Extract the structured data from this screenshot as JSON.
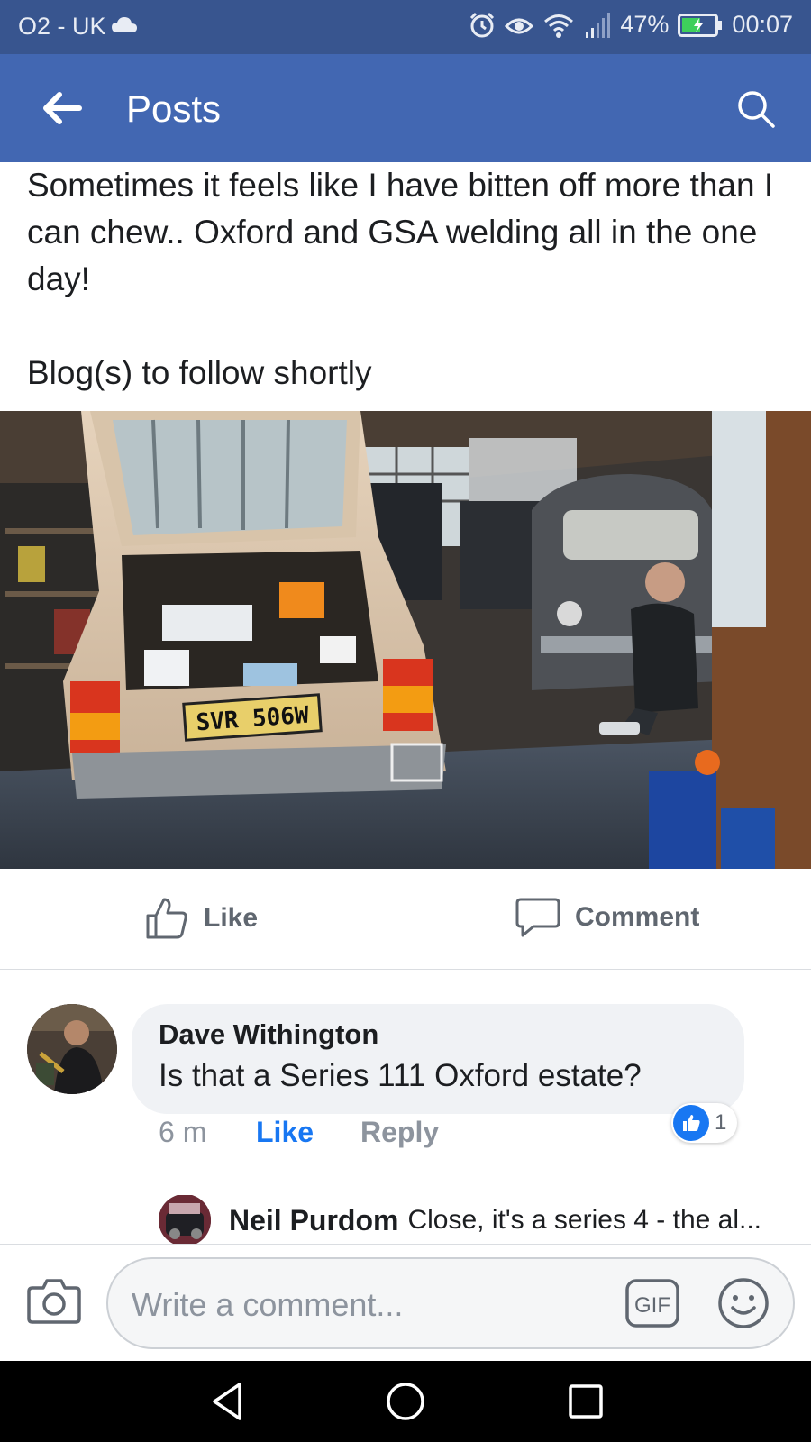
{
  "status_bar": {
    "carrier": "O2 - UK",
    "battery_percent": "47%",
    "time": "00:07",
    "icons": [
      "cloud-icon",
      "alarm-icon",
      "eye-icon",
      "wifi-icon",
      "signal-icon",
      "battery-icon"
    ]
  },
  "app_bar": {
    "title": "Posts",
    "back_icon": "arrow-left-icon",
    "search_icon": "search-icon",
    "background": "#4267b2"
  },
  "post": {
    "text_line1": "Sometimes it feels like I have bitten off more than I can chew.. Oxford and GSA welding all in the one day!",
    "text_line2": "Blog(s) to follow shortly",
    "photo": {
      "plate": "SVR 506W"
    }
  },
  "actions": {
    "like_label": "Like",
    "comment_label": "Comment"
  },
  "comment": {
    "author": "Dave Withington",
    "text": "Is that a Series 111 Oxford estate?",
    "time": "6 m",
    "like_label": "Like",
    "reply_label": "Reply",
    "reaction_count": "1"
  },
  "reply": {
    "author": "Neil Purdom",
    "text": "Close, it's a series 4 - the al..."
  },
  "composer": {
    "placeholder": "Write a comment...",
    "gif_label": "GIF"
  },
  "colors": {
    "brand_blue": "#4267b2",
    "status_blue": "#38558f",
    "link_blue": "#1877f2"
  }
}
